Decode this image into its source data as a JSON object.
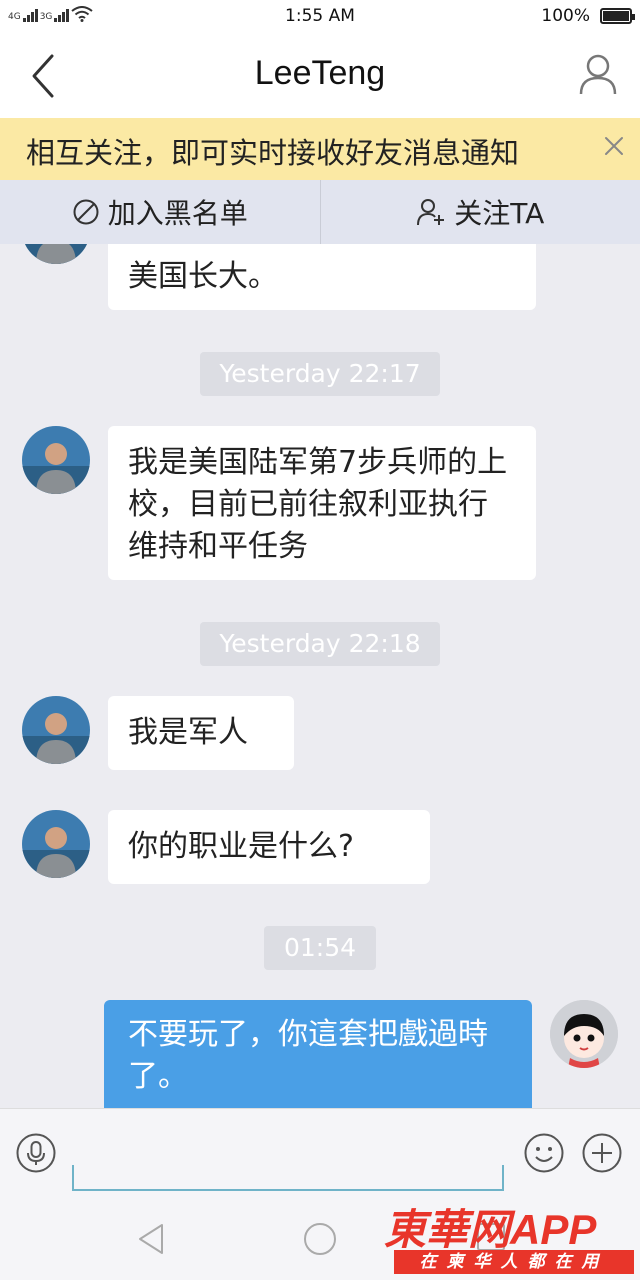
{
  "status": {
    "network1": "4G",
    "network2": "3G",
    "time": "1:55 AM",
    "battery": "100%"
  },
  "header": {
    "title": "LeeTeng",
    "back_icon": "chevron-left-icon",
    "user_icon": "user-profile-icon"
  },
  "notice": {
    "text": "相互关注，即可实时接收好友消息通知",
    "close_icon": "close-icon"
  },
  "actions": {
    "block": "加入黑名单",
    "follow": "关注TA"
  },
  "messages": [
    {
      "type": "incoming",
      "text": "我最初来自中国，但我在美国长大。",
      "visible_text": "美国长大。"
    },
    {
      "type": "timestamp",
      "text": "Yesterday 22:17"
    },
    {
      "type": "incoming",
      "text": "我是美国陆军第7步兵师的上校，目前已前往叙利亚执行维持和平任务"
    },
    {
      "type": "timestamp",
      "text": "Yesterday 22:18"
    },
    {
      "type": "incoming",
      "text": "我是军人"
    },
    {
      "type": "incoming",
      "text": "你的职业是什么?"
    },
    {
      "type": "timestamp",
      "text": "01:54"
    },
    {
      "type": "outgoing",
      "text": "不要玩了，你這套把戲過時了。"
    }
  ],
  "watermark": {
    "brand": "東華网APP",
    "slogan": "在柬华人都在用"
  },
  "colors": {
    "accent": "#4a9fe6",
    "notice_bg": "#fbe9a4",
    "watermark": "#e8352a"
  }
}
